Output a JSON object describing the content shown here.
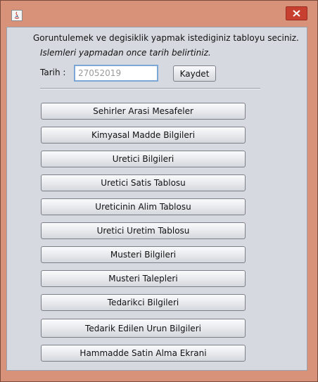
{
  "window": {
    "icon": "java-app-icon",
    "close_icon": "close-icon"
  },
  "form": {
    "instruction": "Goruntulemek ve degisiklik yapmak istediginiz tabloyu seciniz.",
    "note": "Islemleri yapmadan once tarih belirtiniz.",
    "date_label": "Tarih :",
    "date_value": "27052019",
    "save_label": "Kaydet"
  },
  "buttons": [
    "Sehirler Arasi Mesafeler",
    "Kimyasal Madde Bilgileri",
    "Uretici Bilgileri",
    "Uretici Satis Tablosu",
    "Ureticinin Alim Tablosu",
    "Uretici Uretim Tablosu",
    "Musteri Bilgileri",
    "Musteri Talepleri",
    "Tedarikci Bilgileri",
    "Tedarik Edilen Urun Bilgileri",
    "Hammadde Satin Alma Ekrani"
  ],
  "colors": {
    "frame": "#d9927a",
    "close_button": "#c7402f",
    "panel": "#d6d9df",
    "input_focus_border": "#7ba6d6"
  }
}
